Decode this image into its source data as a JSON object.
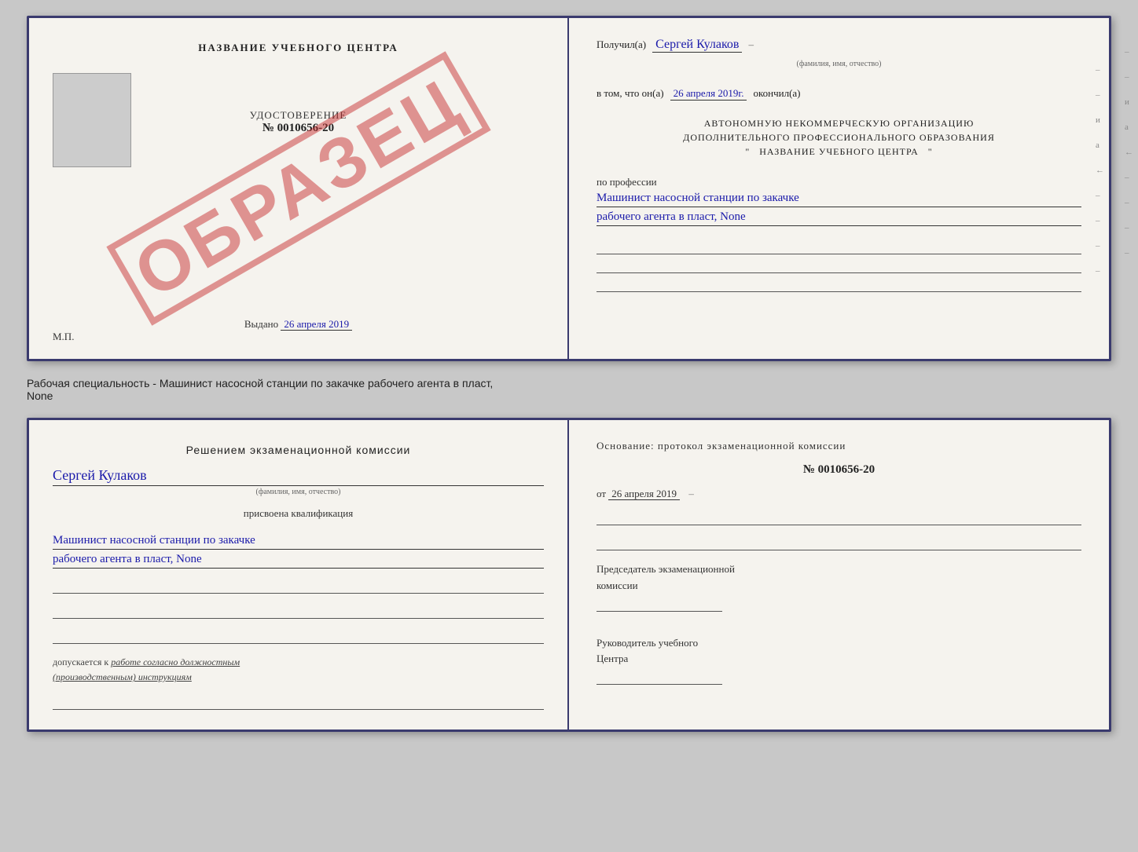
{
  "top_document": {
    "left": {
      "center_title": "НАЗВАНИЕ УЧЕБНОГО ЦЕНТРА",
      "watermark": "ОБРАЗЕЦ",
      "udostoverenie": {
        "title": "УДОСТОВЕРЕНИЕ",
        "number": "№ 0010656-20"
      },
      "vydano": "Выдано",
      "vydano_date": "26 апреля 2019",
      "mp_label": "М.П."
    },
    "right": {
      "poluchil_label": "Получил(а)",
      "poluchil_name": "Сергей Кулаков",
      "familiya_hint": "(фамилия, имя, отчество)",
      "v_tom_label": "в том, что он(а)",
      "date_value": "26 апреля 2019г.",
      "okonchil_label": "окончил(а)",
      "org_block": "АВТОНОМНУЮ НЕКОММЕРЧЕСКУЮ ОРГАНИЗАЦИЮ\nДОПОЛНИТЕЛЬНОГО ПРОФЕССИОНАЛЬНОГО ОБРАЗОВАНИЯ\n\"   НАЗВАНИЕ УЧЕБНОГО ЦЕНТРА   \"",
      "po_professii": "по профессии",
      "profession_line1": "Машинист насосной станции по закачке",
      "profession_line2": "рабочего агента в пласт, None"
    }
  },
  "between_label": "Рабочая специальность - Машинист насосной станции по закачке рабочего агента в пласт,\nNone",
  "bottom_document": {
    "left": {
      "resheniem_title": "Решением экзаменационной комиссии",
      "name_handwritten": "Сергей Кулаков",
      "name_hint": "(фамилия, имя, отчество)",
      "prisvoena_label": "присвоена квалификация",
      "qual_line1": "Машинист насосной станции по закачке",
      "qual_line2": "рабочего агента в пласт, None",
      "допускается_label": "допускается к",
      "допускается_text": "работе согласно должностным\n(производственным) инструкциям"
    },
    "right": {
      "osnovanie_title": "Основание: протокол экзаменационной комиссии",
      "protocol_number": "№  0010656-20",
      "ot_label": "от",
      "ot_date": "26 апреля 2019",
      "predsedatel_label": "Председатель экзаменационной\nкомиссии",
      "rukovoditel_label": "Руководитель учебного\nЦентра"
    }
  }
}
